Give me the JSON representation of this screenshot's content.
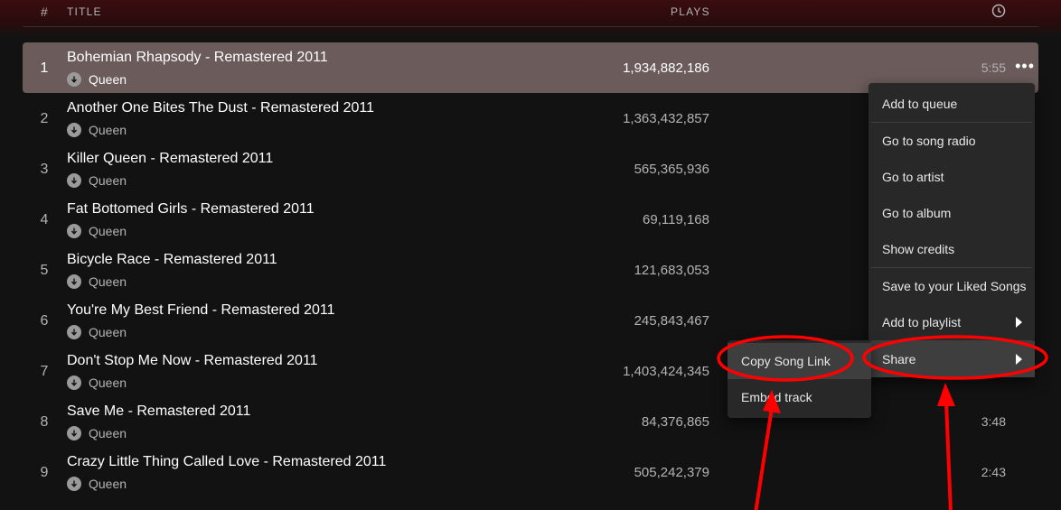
{
  "header": {
    "number_label": "#",
    "title_label": "TITLE",
    "plays_label": "PLAYS",
    "duration_icon": "clock-icon"
  },
  "tracks": [
    {
      "num": "1",
      "title": "Bohemian Rhapsody - Remastered 2011",
      "artist": "Queen",
      "plays": "1,934,882,186",
      "duration": "5:55",
      "selected": true
    },
    {
      "num": "2",
      "title": "Another One Bites The Dust - Remastered 2011",
      "artist": "Queen",
      "plays": "1,363,432,857",
      "duration": ""
    },
    {
      "num": "3",
      "title": "Killer Queen - Remastered 2011",
      "artist": "Queen",
      "plays": "565,365,936",
      "duration": ""
    },
    {
      "num": "4",
      "title": "Fat Bottomed Girls - Remastered 2011",
      "artist": "Queen",
      "plays": "69,119,168",
      "duration": ""
    },
    {
      "num": "5",
      "title": "Bicycle Race - Remastered 2011",
      "artist": "Queen",
      "plays": "121,683,053",
      "duration": ""
    },
    {
      "num": "6",
      "title": "You're My Best Friend - Remastered 2011",
      "artist": "Queen",
      "plays": "245,843,467",
      "duration": ""
    },
    {
      "num": "7",
      "title": "Don't Stop Me Now - Remastered 2011",
      "artist": "Queen",
      "plays": "1,403,424,345",
      "duration": ""
    },
    {
      "num": "8",
      "title": "Save Me - Remastered 2011",
      "artist": "Queen",
      "plays": "84,376,865",
      "duration": "3:48"
    },
    {
      "num": "9",
      "title": "Crazy Little Thing Called Love - Remastered 2011",
      "artist": "Queen",
      "plays": "505,242,379",
      "duration": "2:43"
    }
  ],
  "more_button": "•••",
  "context_menu": {
    "items": [
      "Add to queue",
      "Go to song radio",
      "Go to artist",
      "Go to album",
      "Show credits",
      "Save to your Liked Songs",
      "Add to playlist",
      "Share"
    ]
  },
  "share_submenu": {
    "items": [
      "Copy Song Link",
      "Embed track"
    ]
  },
  "colors": {
    "background": "#121212",
    "selected_row": "#6b5b5b",
    "menu_bg": "#282828",
    "annotation_red": "#ff0000"
  }
}
